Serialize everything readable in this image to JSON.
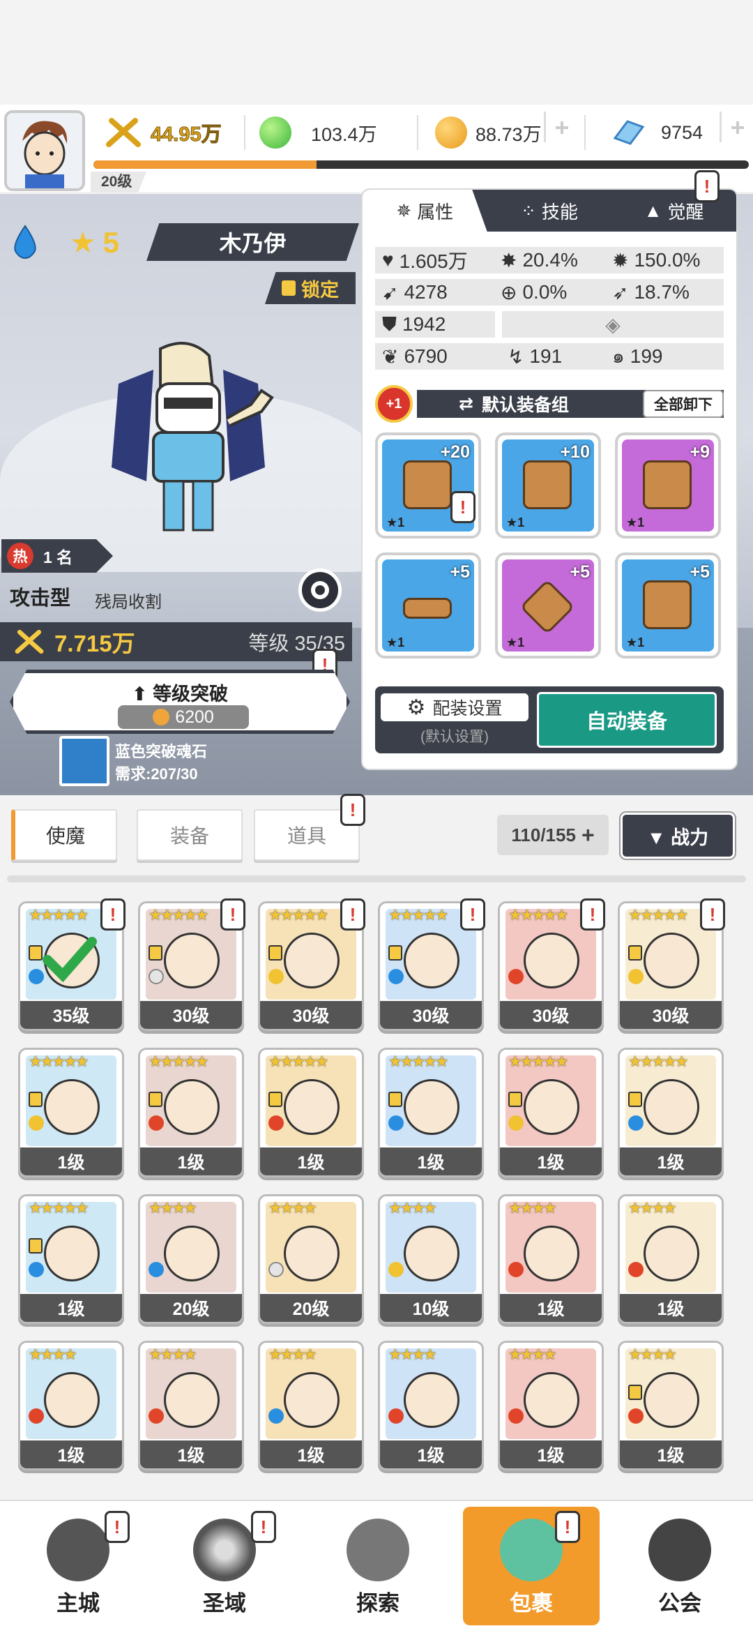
{
  "header": {
    "power": "44.95万",
    "green_currency": "103.4万",
    "gold": "88.73万",
    "gems": "9754",
    "player_level": "20级",
    "exp_fraction": 0.34
  },
  "hero": {
    "element": "water",
    "stars": "5",
    "name": "木乃伊",
    "lock_label": "锁定",
    "hot_label": "热",
    "rank": "1 名",
    "type": "攻击型",
    "type_desc": "残局收割",
    "power": "7.715万",
    "level": "等级 35/35",
    "break_title": "等级突破",
    "break_cost": "6200",
    "stone_name": "蓝色突破魂石",
    "stone_need": "需求:207/30"
  },
  "panel": {
    "tabs": [
      {
        "label": "属性"
      },
      {
        "label": "技能"
      },
      {
        "label": "觉醒"
      }
    ],
    "stats": {
      "hp": "1.605万",
      "crit": "20.4%",
      "crit_dmg": "150.0%",
      "atk": "4278",
      "hit": "0.0%",
      "speed": "18.7%",
      "def": "1942",
      "extra1": "6790",
      "extra2": "191",
      "extra3": "199"
    },
    "plus_badge": "+1",
    "set_name": "默认装备组",
    "unequip_all": "全部卸下",
    "equipment": [
      {
        "level": "+20",
        "stars": "★1",
        "rarity": "blue",
        "icon": "sword-icon"
      },
      {
        "level": "+10",
        "stars": "★1",
        "rarity": "blue",
        "icon": "chest-icon"
      },
      {
        "level": "+9",
        "stars": "★1",
        "rarity": "purple",
        "icon": "armor-icon"
      },
      {
        "level": "+5",
        "stars": "★1",
        "rarity": "blue",
        "icon": "belt-icon"
      },
      {
        "level": "+5",
        "stars": "★1",
        "rarity": "purple",
        "icon": "necklace-icon"
      },
      {
        "level": "+5",
        "stars": "★1",
        "rarity": "blue",
        "icon": "boot-icon"
      }
    ],
    "config_label": "配装设置",
    "config_sub": "(默认设置)",
    "auto_equip": "自动装备"
  },
  "inventory": {
    "tabs": [
      {
        "label": "使魔"
      },
      {
        "label": "装备"
      },
      {
        "label": "道具"
      }
    ],
    "count": "110/155",
    "sort_label": "▼ 战力",
    "cards": [
      {
        "stars": "★★★★★",
        "level": "35级",
        "element": "water",
        "locked": true
      },
      {
        "stars": "★★★★★",
        "level": "30级",
        "element": "light",
        "locked": true
      },
      {
        "stars": "★★★★★",
        "level": "30级",
        "element": "wind",
        "locked": true
      },
      {
        "stars": "★★★★★",
        "level": "30级",
        "element": "water",
        "locked": true
      },
      {
        "stars": "★★★★★",
        "level": "30级",
        "element": "fire",
        "locked": false
      },
      {
        "stars": "★★★★★",
        "level": "30级",
        "element": "wind",
        "locked": true
      },
      {
        "stars": "★★★★★",
        "level": "1级",
        "element": "wind",
        "locked": true
      },
      {
        "stars": "★★★★★",
        "level": "1级",
        "element": "fire",
        "locked": true
      },
      {
        "stars": "★★★★★",
        "level": "1级",
        "element": "fire",
        "locked": true
      },
      {
        "stars": "★★★★★",
        "level": "1级",
        "element": "water",
        "locked": true
      },
      {
        "stars": "★★★★★",
        "level": "1级",
        "element": "wind",
        "locked": true
      },
      {
        "stars": "★★★★★",
        "level": "1级",
        "element": "water",
        "locked": true
      },
      {
        "stars": "★★★★★",
        "level": "1级",
        "element": "water",
        "locked": true
      },
      {
        "stars": "★★★★",
        "level": "20级",
        "element": "water",
        "locked": false
      },
      {
        "stars": "★★★★",
        "level": "20级",
        "element": "light",
        "locked": false
      },
      {
        "stars": "★★★★",
        "level": "10级",
        "element": "wind",
        "locked": false
      },
      {
        "stars": "★★★★",
        "level": "1级",
        "element": "fire",
        "locked": false
      },
      {
        "stars": "★★★★",
        "level": "1级",
        "element": "fire",
        "locked": false
      },
      {
        "stars": "★★★★",
        "level": "1级",
        "element": "fire",
        "locked": false
      },
      {
        "stars": "★★★★",
        "level": "1级",
        "element": "fire",
        "locked": false
      },
      {
        "stars": "★★★★",
        "level": "1级",
        "element": "water",
        "locked": false
      },
      {
        "stars": "★★★★",
        "level": "1级",
        "element": "fire",
        "locked": false
      },
      {
        "stars": "★★★★",
        "level": "1级",
        "element": "fire",
        "locked": false
      },
      {
        "stars": "★★★★",
        "level": "1级",
        "element": "fire",
        "locked": true
      }
    ]
  },
  "nav": [
    {
      "label": "主城",
      "icon": "castle-icon"
    },
    {
      "label": "圣域",
      "icon": "vortex-icon"
    },
    {
      "label": "探索",
      "icon": "sword-stone-icon"
    },
    {
      "label": "包裹",
      "icon": "backpack-icon"
    },
    {
      "label": "公会",
      "icon": "guild-helmet-icon"
    }
  ],
  "alert_mark": "!"
}
